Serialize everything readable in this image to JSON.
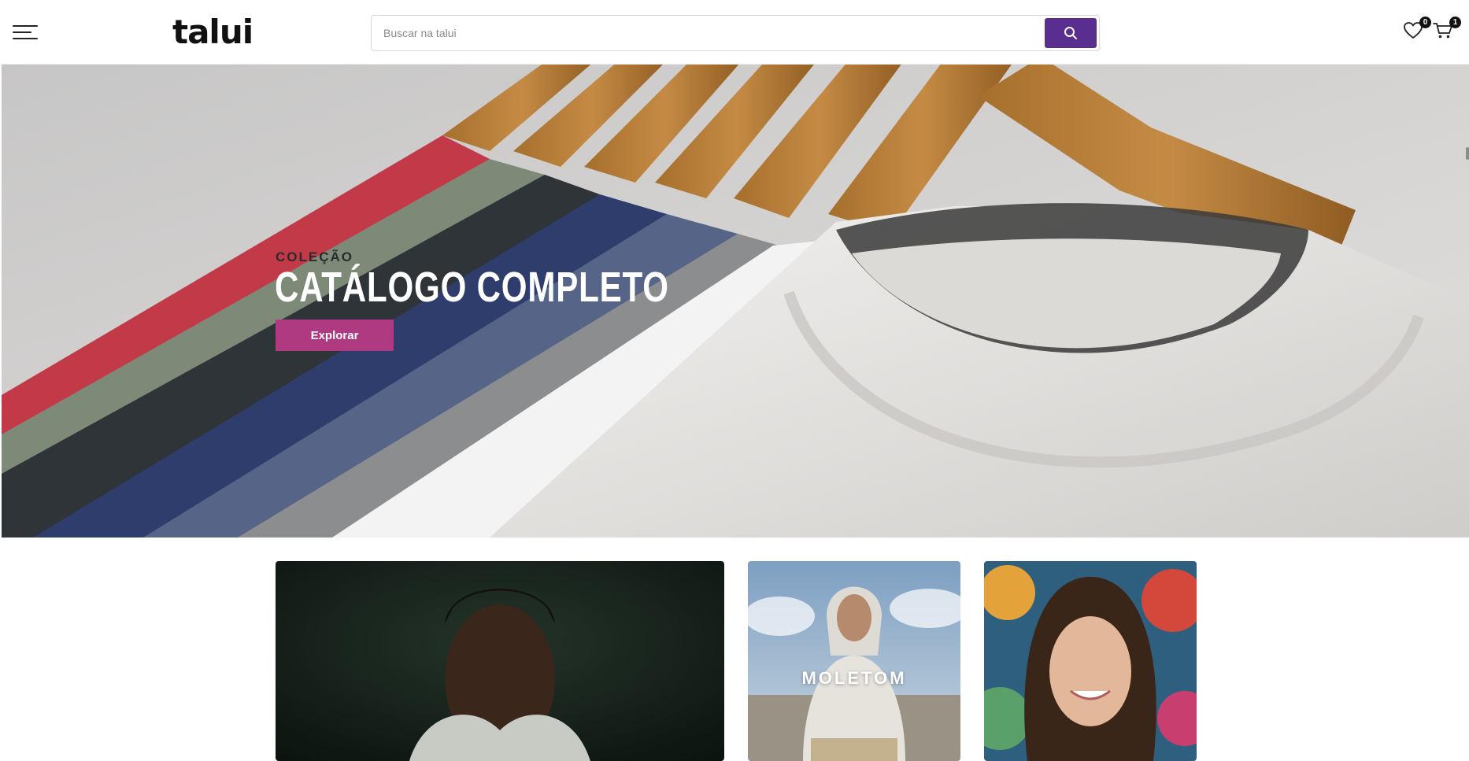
{
  "header": {
    "logo": "talui",
    "menu_icon": "hamburger-menu-icon",
    "search": {
      "placeholder": "Buscar na talui",
      "value": "",
      "button_icon": "search-icon"
    },
    "wishlist": {
      "icon": "heart-icon",
      "count": "0"
    },
    "cart": {
      "icon": "cart-icon",
      "count": "1"
    }
  },
  "hero": {
    "eyebrow": "COLEÇÃO",
    "title": "CATÁLOGO COMPLETO",
    "cta_label": "Explorar"
  },
  "categories": [
    {
      "label": ""
    },
    {
      "label": "MOLETOM"
    },
    {
      "label": ""
    }
  ],
  "colors": {
    "brand_purple": "#5a2d91",
    "cta_magenta": "#b03a82"
  }
}
